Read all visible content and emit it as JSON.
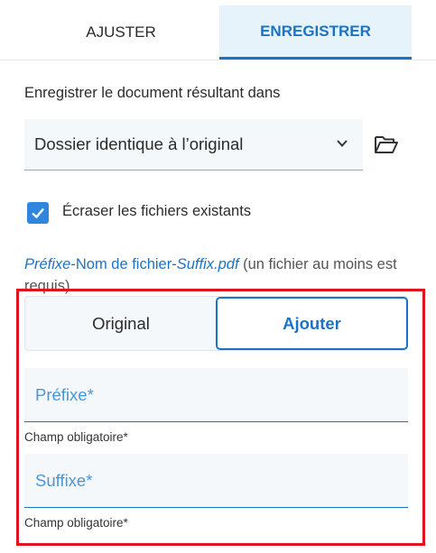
{
  "tabs": [
    {
      "label": "AJUSTER",
      "active": false
    },
    {
      "label": "ENREGISTRER",
      "active": true
    }
  ],
  "save_section": {
    "label": "Enregistrer le document résultant dans",
    "location_select": {
      "value": "Dossier identique à l’original"
    },
    "folder_icon": "folder-open-icon"
  },
  "overwrite": {
    "checked": true,
    "label": "Écraser les fichiers existants"
  },
  "filename_pattern": {
    "prefix": "Préfixe",
    "sep1": "-",
    "middle": "Nom de fichier",
    "sep2": "-",
    "suffix": "Suffix.pdf",
    "note": " (un fichier au moins est requis)"
  },
  "mode_toggle": {
    "options": [
      "Original",
      "Ajouter"
    ],
    "selected": "Ajouter"
  },
  "fields": {
    "prefix": {
      "placeholder": "Préfixe*",
      "value": "",
      "helper": "Champ obligatoire*"
    },
    "suffix": {
      "placeholder": "Suffixe*",
      "value": "",
      "helper": "Champ obligatoire*"
    }
  },
  "colors": {
    "accent": "#1a73c6",
    "checkbox": "#2e86de",
    "highlight_border": "#e0141e",
    "field_background": "#f5f8fb"
  }
}
